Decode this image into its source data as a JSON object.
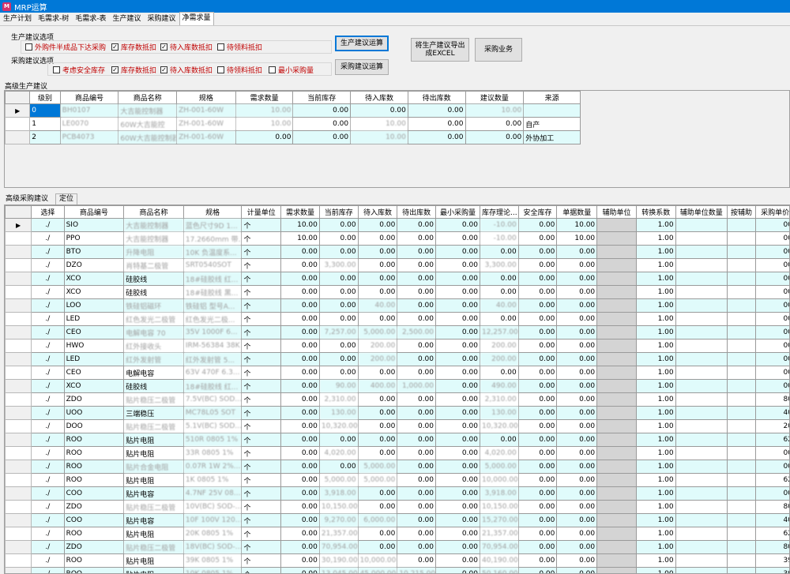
{
  "window": {
    "title": "MRP运算"
  },
  "tabs": [
    "生产计划",
    "毛需求-树",
    "毛需求-表",
    "生产建议",
    "采购建议",
    "净需求量"
  ],
  "active_tab_index": 5,
  "production_options": {
    "group_label": "生产建议选项",
    "checkboxes": [
      {
        "label": "外购件半成品下达采购",
        "checked": false
      },
      {
        "label": "库存数抵扣",
        "checked": true
      },
      {
        "label": "待入库数抵扣",
        "checked": true
      },
      {
        "label": "待领料抵扣",
        "checked": false
      }
    ]
  },
  "purchase_options": {
    "group_label": "采购建议选项",
    "checkboxes": [
      {
        "label": "考虑安全库存",
        "checked": false
      },
      {
        "label": "库存数抵扣",
        "checked": true
      },
      {
        "label": "待入库数抵扣",
        "checked": true
      },
      {
        "label": "待领料抵扣",
        "checked": false
      },
      {
        "label": "最小采购量",
        "checked": false
      }
    ]
  },
  "buttons": {
    "calc_production": "生产建议运算",
    "calc_purchase": "采购建议运算",
    "export_excel": "将生产建议导出成EXCEL",
    "purchase_business": "采购业务"
  },
  "production_section": {
    "title": "高级生产建议",
    "columns": [
      "级别",
      "商品编号",
      "商品名称",
      "规格",
      "需求数量",
      "当前库存",
      "待入库数",
      "待出库数",
      "建议数量",
      "来源"
    ],
    "rows": [
      [
        "0",
        "BH0107",
        "大吉能控制器",
        "ZH-001-60W",
        "10.00",
        "0.00",
        "0.00",
        "0.00",
        "10.00",
        ""
      ],
      [
        "1",
        "LE0070",
        "60W大吉能控",
        "ZH-001-60W",
        "10.00",
        "0.00",
        "10.00",
        "0.00",
        "0.00",
        "自产"
      ],
      [
        "2",
        "PCB4073",
        "60W大吉能控制器",
        "ZH-001-60W",
        "0.00",
        "0.00",
        "10.00",
        "0.00",
        "0.00",
        "外协加工"
      ]
    ]
  },
  "purchase_section": {
    "title": "高级采购建议",
    "tab2": "定位",
    "columns": [
      "选择",
      "商品编号",
      "商品名称",
      "规格",
      "计量单位",
      "需求数量",
      "当前库存",
      "待入库数",
      "待出库数",
      "最小采购量",
      "库存理论...",
      "安全库存",
      "单据数量",
      "辅助单位",
      "转换系数",
      "辅助单位数量",
      "按辅助",
      "采购单价"
    ],
    "rows": [
      {
        "code": "SIO",
        "name": "大吉能控制器",
        "spec": "蓝色尺寸9D 1...",
        "unit": "个",
        "demand": "10.00",
        "stock": "0.00",
        "in": "0.00",
        "out": "0.00",
        "minq": "0.00",
        "theory": "-10.00",
        "safety": "0.00",
        "qty": "10.00",
        "factor": "1.00",
        "price": "00"
      },
      {
        "code": "PPO",
        "name": "大吉能控制器",
        "spec": "17.2660mm 带...",
        "unit": "个",
        "demand": "10.00",
        "stock": "0.00",
        "in": "0.00",
        "out": "0.00",
        "minq": "0.00",
        "theory": "-10.00",
        "safety": "0.00",
        "qty": "10.00",
        "factor": "1.00",
        "price": "00"
      },
      {
        "code": "BTO",
        "name": "升降电阻",
        "spec": "10K 负温度系...",
        "unit": "个",
        "demand": "0.00",
        "stock": "0.00",
        "in": "0.00",
        "out": "0.00",
        "minq": "0.00",
        "theory": "0.00",
        "safety": "0.00",
        "qty": "0.00",
        "factor": "1.00",
        "price": "00"
      },
      {
        "code": "DZO",
        "name": "肖特基二极管",
        "spec": "SRT0540SOT",
        "unit": "个",
        "demand": "0.00",
        "stock": "3,300.00",
        "in": "0.00",
        "out": "0.00",
        "minq": "0.00",
        "theory": "3,300.00",
        "safety": "0.00",
        "qty": "0.00",
        "factor": "1.00",
        "price": "00"
      },
      {
        "code": "XCO",
        "name": "硅胶线",
        "spec": "18#硅胶线 红...",
        "unit": "个",
        "demand": "0.00",
        "stock": "0.00",
        "in": "0.00",
        "out": "0.00",
        "minq": "0.00",
        "theory": "0.00",
        "safety": "0.00",
        "qty": "0.00",
        "factor": "1.00",
        "price": "00"
      },
      {
        "code": "XCO",
        "name": "硅胶线",
        "spec": "18#硅胶线 黑...",
        "unit": "个",
        "demand": "0.00",
        "stock": "0.00",
        "in": "0.00",
        "out": "0.00",
        "minq": "0.00",
        "theory": "0.00",
        "safety": "0.00",
        "qty": "0.00",
        "factor": "1.00",
        "price": "00"
      },
      {
        "code": "LOO",
        "name": "铁硅铝磁环",
        "spec": "铁硅铝 型号A...",
        "unit": "个",
        "demand": "0.00",
        "stock": "0.00",
        "in": "40.00",
        "out": "0.00",
        "minq": "0.00",
        "theory": "40.00",
        "safety": "0.00",
        "qty": "0.00",
        "factor": "1.00",
        "price": "00"
      },
      {
        "code": "LED",
        "name": "红色发光二极管",
        "spec": "红色发光二极...",
        "unit": "个",
        "demand": "0.00",
        "stock": "0.00",
        "in": "0.00",
        "out": "0.00",
        "minq": "0.00",
        "theory": "0.00",
        "safety": "0.00",
        "qty": "0.00",
        "factor": "1.00",
        "price": "00"
      },
      {
        "code": "CEO",
        "name": "电解电容 70",
        "spec": "35V 1000F 6...",
        "unit": "个",
        "demand": "0.00",
        "stock": "7,257.00",
        "in": "5,000.00",
        "out": "2,500.00",
        "minq": "0.00",
        "theory": "12,257.00",
        "safety": "0.00",
        "qty": "0.00",
        "factor": "1.00",
        "price": "00"
      },
      {
        "code": "HWO",
        "name": "红外接收头",
        "spec": "IRM-56384 38K",
        "unit": "个",
        "demand": "0.00",
        "stock": "0.00",
        "in": "200.00",
        "out": "0.00",
        "minq": "0.00",
        "theory": "200.00",
        "safety": "0.00",
        "qty": "0.00",
        "factor": "1.00",
        "price": "00"
      },
      {
        "code": "LED",
        "name": "红外发射管",
        "spec": "红外发射管 5...",
        "unit": "个",
        "demand": "0.00",
        "stock": "0.00",
        "in": "200.00",
        "out": "0.00",
        "minq": "0.00",
        "theory": "200.00",
        "safety": "0.00",
        "qty": "0.00",
        "factor": "1.00",
        "price": "00"
      },
      {
        "code": "CEO",
        "name": "电解电容",
        "spec": "63V 470F 6.3...",
        "unit": "个",
        "demand": "0.00",
        "stock": "0.00",
        "in": "0.00",
        "out": "0.00",
        "minq": "0.00",
        "theory": "0.00",
        "safety": "0.00",
        "qty": "0.00",
        "factor": "1.00",
        "price": "00"
      },
      {
        "code": "XCO",
        "name": "硅胶线",
        "spec": "18#硅胶线 红...",
        "unit": "个",
        "demand": "0.00",
        "stock": "90.00",
        "in": "400.00",
        "out": "1,000.00",
        "minq": "0.00",
        "theory": "490.00",
        "safety": "0.00",
        "qty": "0.00",
        "factor": "1.00",
        "price": "00"
      },
      {
        "code": "ZDO",
        "name": "贴片稳压二极管",
        "spec": "7.5V(BC) SOD...",
        "unit": "个",
        "demand": "0.00",
        "stock": "2,310.00",
        "in": "0.00",
        "out": "0.00",
        "minq": "0.00",
        "theory": "2,310.00",
        "safety": "0.00",
        "qty": "0.00",
        "factor": "1.00",
        "price": "80"
      },
      {
        "code": "UOO",
        "name": "三端稳压",
        "spec": "MC78L05 SOT",
        "unit": "个",
        "demand": "0.00",
        "stock": "130.00",
        "in": "0.00",
        "out": "0.00",
        "minq": "0.00",
        "theory": "130.00",
        "safety": "0.00",
        "qty": "0.00",
        "factor": "1.00",
        "price": "40"
      },
      {
        "code": "DOO",
        "name": "贴片稳压二极管",
        "spec": "5.1V(BC) SOD...",
        "unit": "个",
        "demand": "0.00",
        "stock": "10,320.00",
        "in": "0.00",
        "out": "0.00",
        "minq": "0.00",
        "theory": "10,320.00",
        "safety": "0.00",
        "qty": "0.00",
        "factor": "1.00",
        "price": "20"
      },
      {
        "code": "ROO",
        "name": "贴片电阻",
        "spec": "510R 0805 1%",
        "unit": "个",
        "demand": "0.00",
        "stock": "0.00",
        "in": "0.00",
        "out": "0.00",
        "minq": "0.00",
        "theory": "0.00",
        "safety": "0.00",
        "qty": "0.00",
        "factor": "1.00",
        "price": "62"
      },
      {
        "code": "ROO",
        "name": "贴片电阻",
        "spec": "33R 0805 1%",
        "unit": "个",
        "demand": "0.00",
        "stock": "4,020.00",
        "in": "0.00",
        "out": "0.00",
        "minq": "0.00",
        "theory": "4,020.00",
        "safety": "0.00",
        "qty": "0.00",
        "factor": "1.00",
        "price": "00"
      },
      {
        "code": "ROO",
        "name": "贴片合金电阻",
        "spec": "0.07R 1W 2%...",
        "unit": "个",
        "demand": "0.00",
        "stock": "0.00",
        "in": "5,000.00",
        "out": "0.00",
        "minq": "0.00",
        "theory": "5,000.00",
        "safety": "0.00",
        "qty": "0.00",
        "factor": "1.00",
        "price": "00"
      },
      {
        "code": "ROO",
        "name": "贴片电阻",
        "spec": "1K 0805 1%",
        "unit": "个",
        "demand": "0.00",
        "stock": "5,000.00",
        "in": "5,000.00",
        "out": "0.00",
        "minq": "0.00",
        "theory": "10,000.00",
        "safety": "0.00",
        "qty": "0.00",
        "factor": "1.00",
        "price": "62"
      },
      {
        "code": "COO",
        "name": "贴片电容",
        "spec": "4.7NF 25V 08...",
        "unit": "个",
        "demand": "0.00",
        "stock": "3,918.00",
        "in": "0.00",
        "out": "0.00",
        "minq": "0.00",
        "theory": "3,918.00",
        "safety": "0.00",
        "qty": "0.00",
        "factor": "1.00",
        "price": "00"
      },
      {
        "code": "ZDO",
        "name": "贴片稳压二极管",
        "spec": "10V(BC) SOD-...",
        "unit": "个",
        "demand": "0.00",
        "stock": "10,150.00",
        "in": "0.00",
        "out": "0.00",
        "minq": "0.00",
        "theory": "10,150.00",
        "safety": "0.00",
        "qty": "0.00",
        "factor": "1.00",
        "price": "80"
      },
      {
        "code": "COO",
        "name": "贴片电容",
        "spec": "10F 100V 120...",
        "unit": "个",
        "demand": "0.00",
        "stock": "9,270.00",
        "in": "6,000.00",
        "out": "0.00",
        "minq": "0.00",
        "theory": "15,270.00",
        "safety": "0.00",
        "qty": "0.00",
        "factor": "1.00",
        "price": "40"
      },
      {
        "code": "ROO",
        "name": "贴片电阻",
        "spec": "20K 0805 1%",
        "unit": "个",
        "demand": "0.00",
        "stock": "21,357.00",
        "in": "0.00",
        "out": "0.00",
        "minq": "0.00",
        "theory": "21,357.00",
        "safety": "0.00",
        "qty": "0.00",
        "factor": "1.00",
        "price": "62"
      },
      {
        "code": "ZDO",
        "name": "贴片稳压二极管",
        "spec": "18V(BC) SOD-...",
        "unit": "个",
        "demand": "0.00",
        "stock": "70,954.00",
        "in": "0.00",
        "out": "0.00",
        "minq": "0.00",
        "theory": "70,954.00",
        "safety": "0.00",
        "qty": "0.00",
        "factor": "1.00",
        "price": "80"
      },
      {
        "code": "ROO",
        "name": "贴片电阻",
        "spec": "39K 0805 1%",
        "unit": "个",
        "demand": "0.00",
        "stock": "30,190.00",
        "in": "10,000.00",
        "out": "0.00",
        "minq": "0.00",
        "theory": "40,190.00",
        "safety": "0.00",
        "qty": "0.00",
        "factor": "1.00",
        "price": "39"
      },
      {
        "code": "ROO",
        "name": "贴片电阻",
        "spec": "10K 0805 1%",
        "unit": "个",
        "demand": "0.00",
        "stock": "13,045.00",
        "in": "45,000.00",
        "out": "10,215.00",
        "minq": "0.00",
        "theory": "50,160.00",
        "safety": "0.00",
        "qty": "0.00",
        "factor": "1.00",
        "price": "39"
      }
    ],
    "clear_name_rows": [
      4,
      5,
      11,
      12,
      14,
      16,
      17,
      19,
      20,
      22,
      23,
      25,
      26
    ]
  }
}
